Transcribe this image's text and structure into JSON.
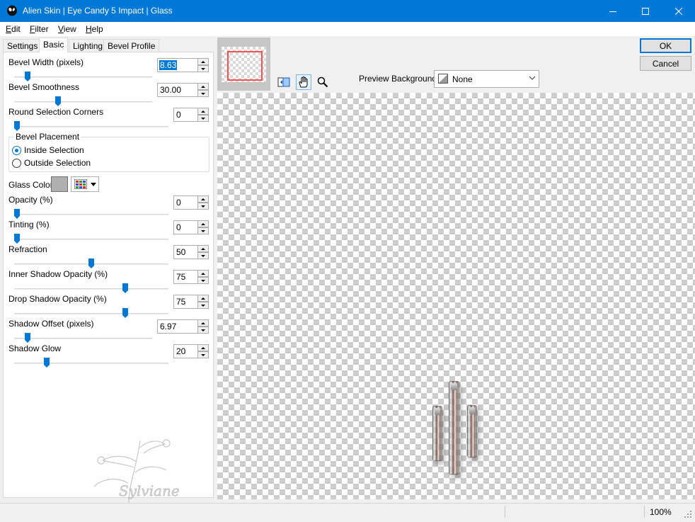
{
  "window": {
    "title": "Alien Skin | Eye Candy 5 Impact | Glass"
  },
  "menu": {
    "edit": "Edit",
    "filter": "Filter",
    "view": "View",
    "help": "Help"
  },
  "tabs": [
    {
      "label": "Settings",
      "active": false
    },
    {
      "label": "Basic",
      "active": true
    },
    {
      "label": "Lighting",
      "active": false
    },
    {
      "label": "Bevel Profile",
      "active": false
    }
  ],
  "params": {
    "bevel_width": {
      "label": "Bevel Width (pixels)",
      "value": "8.63",
      "level": 0.08
    },
    "bevel_smoothness": {
      "label": "Bevel Smoothness",
      "value": "30.00",
      "level": 0.31
    },
    "round_corners": {
      "label": "Round Selection Corners",
      "value": "0",
      "level": 0.0
    },
    "opacity": {
      "label": "Opacity (%)",
      "value": "0",
      "level": 0.0
    },
    "tinting": {
      "label": "Tinting (%)",
      "value": "0",
      "level": 0.0
    },
    "refraction": {
      "label": "Refraction",
      "value": "50",
      "level": 0.5
    },
    "inner_shadow": {
      "label": "Inner Shadow Opacity (%)",
      "value": "75",
      "level": 0.73
    },
    "drop_shadow": {
      "label": "Drop Shadow Opacity (%)",
      "value": "75",
      "level": 0.73
    },
    "shadow_offset": {
      "label": "Shadow Offset (pixels)",
      "value": "6.97",
      "level": 0.08
    },
    "shadow_glow": {
      "label": "Shadow Glow",
      "value": "20",
      "level": 0.2
    }
  },
  "bevel_placement": {
    "legend": "Bevel Placement",
    "inside": "Inside Selection",
    "outside": "Outside Selection",
    "selected": "inside"
  },
  "glass_color": {
    "label": "Glass Color",
    "color": "#b0b0b0"
  },
  "watermark_text": "Sylviane",
  "preview": {
    "background_label": "Preview Background:",
    "background_value": "None"
  },
  "buttons": {
    "ok": "OK",
    "cancel": "Cancel"
  },
  "status": {
    "zoom": "100%"
  },
  "colors": {
    "titlebar": "#0078d7",
    "slider_thumb": "#0078d7",
    "thumb_rect": "#ff5050"
  }
}
